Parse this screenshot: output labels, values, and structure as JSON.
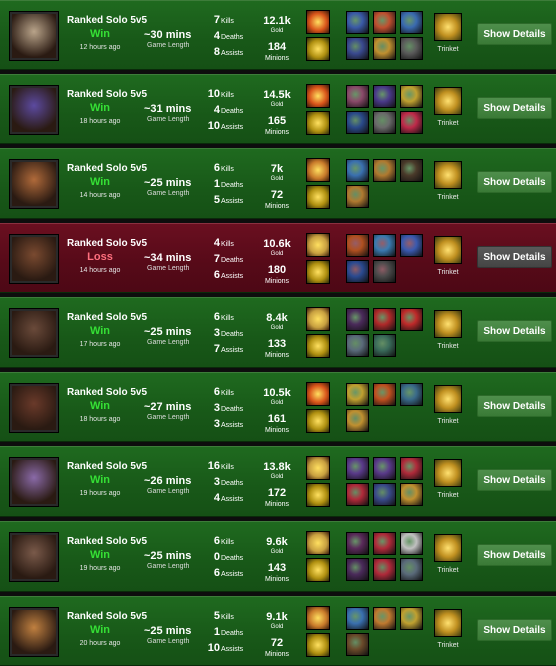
{
  "labels": {
    "game_length": "Game Length",
    "kills": "Kills",
    "deaths": "Deaths",
    "assists": "Assists",
    "gold": "Gold",
    "minions": "Minions",
    "trinket": "Trinket",
    "show_details": "Show Details"
  },
  "colors": {
    "win_bg": "#185818",
    "loss_bg": "#560a18",
    "win_text": "#35e035",
    "loss_text": "#ff6f7e"
  },
  "matches": [
    {
      "queue": "Ranked Solo 5v5",
      "result": "Win",
      "outcome": "win",
      "ago": "12 hours ago",
      "length": "~30 mins",
      "kills": "7",
      "deaths": "4",
      "assists": "8",
      "gold": "12.1k",
      "minions": "184",
      "champion": "champion-portrait",
      "spells": [
        "flash-spell-icon",
        "ignite-spell-icon"
      ],
      "items": [
        "item-icon",
        "item-icon",
        "item-icon",
        "item-icon",
        "item-icon",
        "item-icon"
      ]
    },
    {
      "queue": "Ranked Solo 5v5",
      "result": "Win",
      "outcome": "win",
      "ago": "18 hours ago",
      "length": "~31 mins",
      "kills": "10",
      "deaths": "4",
      "assists": "10",
      "gold": "14.5k",
      "minions": "165"
    },
    {
      "queue": "Ranked Solo 5v5",
      "result": "Win",
      "outcome": "win",
      "ago": "14 hours ago",
      "length": "~25 mins",
      "kills": "6",
      "deaths": "1",
      "assists": "5",
      "gold": "7k",
      "minions": "72"
    },
    {
      "queue": "Ranked Solo 5v5",
      "result": "Loss",
      "outcome": "loss",
      "ago": "14 hours ago",
      "length": "~34 mins",
      "kills": "4",
      "deaths": "7",
      "assists": "6",
      "gold": "10.6k",
      "minions": "180"
    },
    {
      "queue": "Ranked Solo 5v5",
      "result": "Win",
      "outcome": "win",
      "ago": "17 hours ago",
      "length": "~25 mins",
      "kills": "6",
      "deaths": "3",
      "assists": "7",
      "gold": "8.4k",
      "minions": "133"
    },
    {
      "queue": "Ranked Solo 5v5",
      "result": "Win",
      "outcome": "win",
      "ago": "18 hours ago",
      "length": "~27 mins",
      "kills": "6",
      "deaths": "3",
      "assists": "3",
      "gold": "10.5k",
      "minions": "161"
    },
    {
      "queue": "Ranked Solo 5v5",
      "result": "Win",
      "outcome": "win",
      "ago": "19 hours ago",
      "length": "~26 mins",
      "kills": "16",
      "deaths": "3",
      "assists": "4",
      "gold": "13.8k",
      "minions": "172"
    },
    {
      "queue": "Ranked Solo 5v5",
      "result": "Win",
      "outcome": "win",
      "ago": "19 hours ago",
      "length": "~25 mins",
      "kills": "6",
      "deaths": "0",
      "assists": "6",
      "gold": "9.6k",
      "minions": "143"
    },
    {
      "queue": "Ranked Solo 5v5",
      "result": "Win",
      "outcome": "win",
      "ago": "20 hours ago",
      "length": "~25 mins",
      "kills": "5",
      "deaths": "1",
      "assists": "10",
      "gold": "9.1k",
      "minions": "72"
    }
  ]
}
